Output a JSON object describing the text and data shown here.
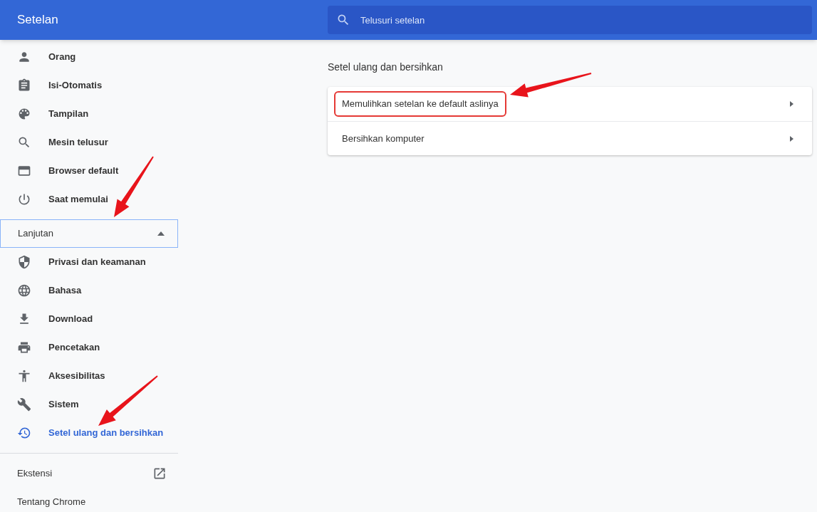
{
  "header": {
    "title": "Setelan",
    "search": {
      "placeholder": "Telusuri setelan"
    }
  },
  "sidebar": {
    "items": [
      {
        "label": "Orang",
        "selected": false
      },
      {
        "label": "Isi-Otomatis",
        "selected": false
      },
      {
        "label": "Tampilan",
        "selected": false
      },
      {
        "label": "Mesin telusur",
        "selected": false
      },
      {
        "label": "Browser default",
        "selected": false
      },
      {
        "label": "Saat memulai",
        "selected": false
      }
    ],
    "advanced": {
      "label": "Lanjutan",
      "expanded": true,
      "items": [
        {
          "label": "Privasi dan keamanan",
          "selected": false
        },
        {
          "label": "Bahasa",
          "selected": false
        },
        {
          "label": "Download",
          "selected": false
        },
        {
          "label": "Pencetakan",
          "selected": false
        },
        {
          "label": "Aksesibilitas",
          "selected": false
        },
        {
          "label": "Sistem",
          "selected": false
        },
        {
          "label": "Setel ulang dan bersihkan",
          "selected": true
        }
      ]
    },
    "footer": [
      {
        "label": "Ekstensi",
        "external": true
      },
      {
        "label": "Tentang Chrome",
        "external": false
      }
    ]
  },
  "main": {
    "section_title": "Setel ulang dan bersihkan",
    "rows": [
      {
        "label": "Memulihkan setelan ke default aslinya",
        "highlighted": true
      },
      {
        "label": "Bersihkan komputer",
        "highlighted": false
      }
    ]
  }
}
